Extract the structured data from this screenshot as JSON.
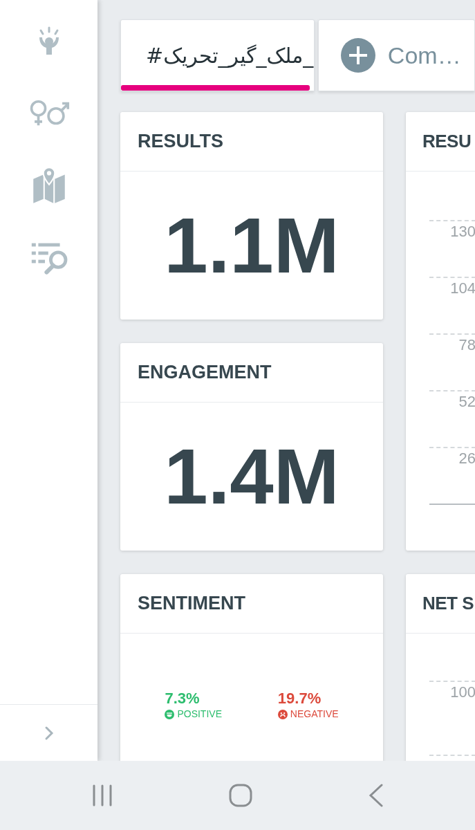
{
  "sidebar": {
    "items": [
      {
        "kind": "person"
      },
      {
        "kind": "gender"
      },
      {
        "kind": "map"
      },
      {
        "kind": "search-list"
      }
    ]
  },
  "tabs": [
    {
      "label": "_ملک_گیر_تحریک#",
      "selected": true,
      "kind": "topic"
    },
    {
      "label": "Com…",
      "selected": false,
      "kind": "add"
    }
  ],
  "left_cards": [
    {
      "title": "RESULTS",
      "kind": "metric",
      "value": "1.1M"
    },
    {
      "title": "ENGAGEMENT",
      "kind": "metric",
      "value": "1.4M"
    },
    {
      "title": "SENTIMENT",
      "kind": "sentiment",
      "items": [
        {
          "value": "7.3%",
          "label": "POSITIVE",
          "kind": "positive",
          "color": "#2dbd6e"
        },
        {
          "value": "19.7%",
          "label": "NEGATIVE",
          "kind": "negative",
          "color": "#dc4a3c"
        }
      ]
    }
  ],
  "right_cards": [
    {
      "title": "RESU",
      "kind": "chart",
      "tick_labels": [
        "130",
        "104",
        "78",
        "52",
        "26"
      ]
    },
    {
      "title": "NET S",
      "kind": "chart",
      "tick_labels": [
        "100"
      ]
    }
  ]
}
